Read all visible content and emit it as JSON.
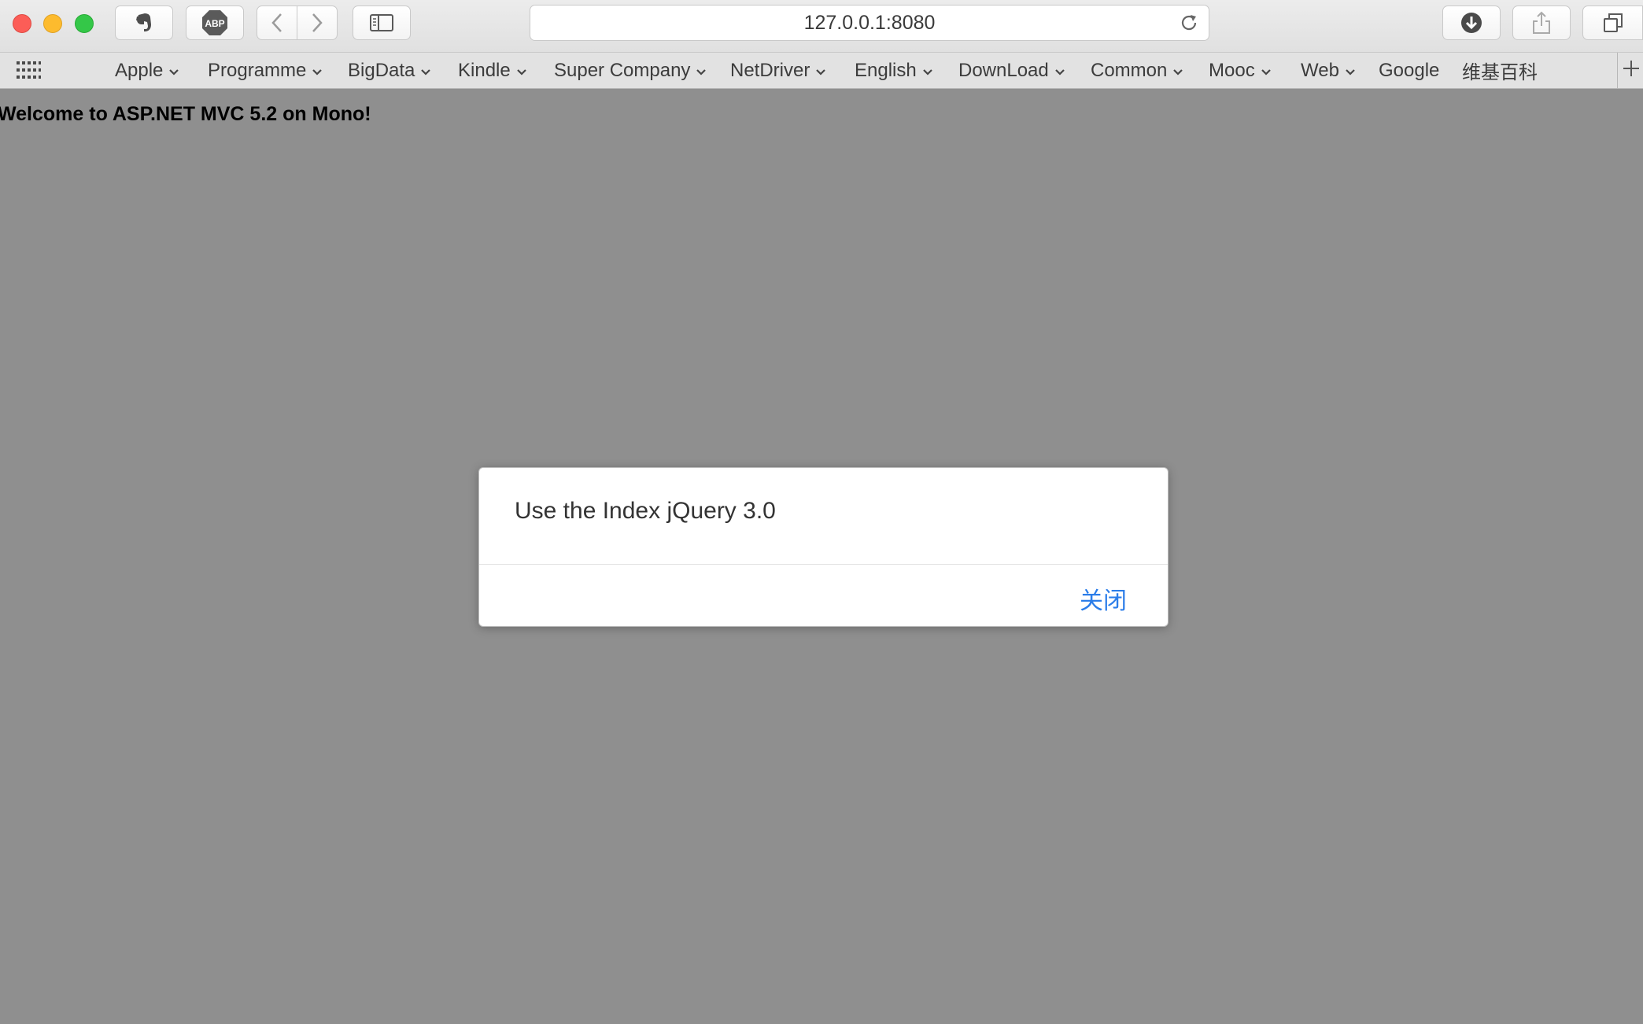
{
  "browser": {
    "url": "127.0.0.1:8080",
    "abp_label": "ABP"
  },
  "bookmarks": [
    {
      "label": "Apple",
      "dropdown": true
    },
    {
      "label": "Programme",
      "dropdown": true
    },
    {
      "label": "BigData",
      "dropdown": true
    },
    {
      "label": "Kindle",
      "dropdown": true
    },
    {
      "label": "Super Company",
      "dropdown": true
    },
    {
      "label": "NetDriver",
      "dropdown": true
    },
    {
      "label": "English",
      "dropdown": true
    },
    {
      "label": "DownLoad",
      "dropdown": true
    },
    {
      "label": "Common",
      "dropdown": true
    },
    {
      "label": "Mooc",
      "dropdown": true
    },
    {
      "label": "Web",
      "dropdown": true
    },
    {
      "label": "Google",
      "dropdown": false
    },
    {
      "label": "维基百科",
      "dropdown": false
    }
  ],
  "page": {
    "heading": "Welcome to ASP.NET MVC 5.2 on Mono!"
  },
  "dialog": {
    "message": "Use the Index jQuery 3.0",
    "close_label": "关闭"
  },
  "colors": {
    "link_blue": "#2b7de9",
    "overlay": "rgba(0,0,0,0.44)",
    "traffic_close": "#fc5d57",
    "traffic_min": "#fdbb2e",
    "traffic_max": "#34c748"
  },
  "icons": {
    "evernote": "elephant-icon",
    "adblock": "abp-icon",
    "back": "chevron-left-icon",
    "forward": "chevron-right-icon",
    "sidebar": "sidebar-icon",
    "reload": "reload-icon",
    "downloads": "download-icon",
    "share": "share-icon",
    "tabs": "tabs-overview-icon",
    "apps": "apps-grid-icon",
    "new_tab": "plus-icon"
  }
}
